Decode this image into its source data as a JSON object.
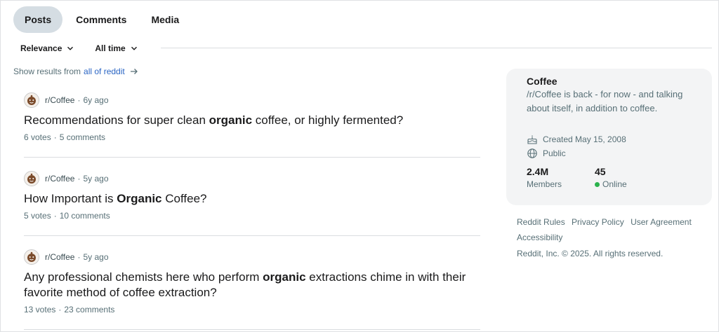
{
  "tabs": [
    {
      "label": "Posts",
      "active": true
    },
    {
      "label": "Comments",
      "active": false
    },
    {
      "label": "Media",
      "active": false
    }
  ],
  "filters": {
    "sort": "Relevance",
    "time": "All time"
  },
  "show_results": {
    "prefix": "Show results from",
    "link": "all of reddit"
  },
  "posts": [
    {
      "subreddit": "r/Coffee",
      "age": "6y ago",
      "title_before": "Recommendations for super clean ",
      "title_bold": "organic",
      "title_after": " coffee, or highly fermented?",
      "votes": "6 votes",
      "comments": "5 comments"
    },
    {
      "subreddit": "r/Coffee",
      "age": "5y ago",
      "title_before": "How Important is ",
      "title_bold": "Organic",
      "title_after": " Coffee?",
      "votes": "5 votes",
      "comments": "10 comments"
    },
    {
      "subreddit": "r/Coffee",
      "age": "5y ago",
      "title_before": "Any professional chemists here who perform ",
      "title_bold": "organic",
      "title_after": " extractions chime in with their favorite method of coffee extraction?",
      "votes": "13 votes",
      "comments": "23 comments"
    }
  ],
  "sidebar": {
    "name": "Coffee",
    "description": "/r/Coffee is back - for now - and talking about itself, in addition to coffee.",
    "created": "Created May 15, 2008",
    "visibility": "Public",
    "members_count": "2.4M",
    "members_label": "Members",
    "online_count": "45",
    "online_label": "Online"
  },
  "footer": {
    "links": [
      "Reddit Rules",
      "Privacy Policy",
      "User Agreement",
      "Accessibility"
    ],
    "copyright": "Reddit, Inc. © 2025. All rights reserved."
  },
  "colors": {
    "active_tab_bg": "#d5dde3",
    "link": "#2a65c4",
    "online": "#2bb24c",
    "card_bg": "#f3f4f5"
  }
}
